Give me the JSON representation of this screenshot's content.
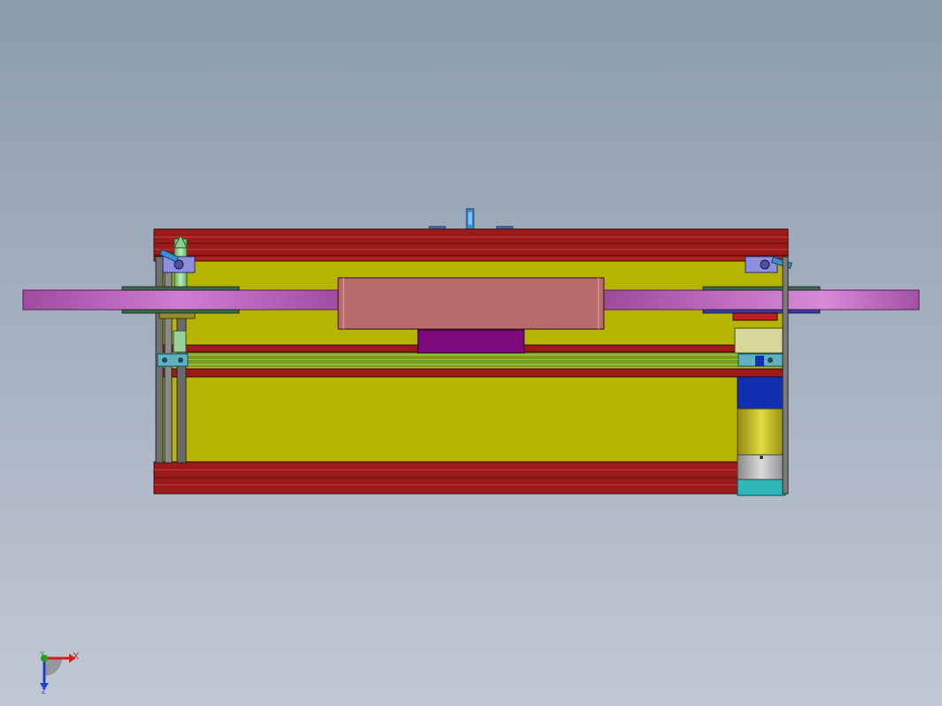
{
  "viewport": {
    "background_top": "#8c9cad",
    "background_bottom": "#c0c8d3",
    "model": {
      "frame_color": "#9b1b1b",
      "panel_color": "#b5b500",
      "rail_color": "#c060c0",
      "block_color": "#b86b6b",
      "pad_color": "#7a0a7a",
      "guide_color": "#8dbf3a",
      "motor_blue": "#1030b0",
      "motor_yellow": "#c8c020",
      "motor_cyan": "#30b8b8"
    }
  },
  "triad": {
    "x_label": "X",
    "y_label": "Y",
    "z_label": "Z",
    "x_color": "#d02020",
    "y_color": "#20a020",
    "z_color": "#2040d0"
  }
}
